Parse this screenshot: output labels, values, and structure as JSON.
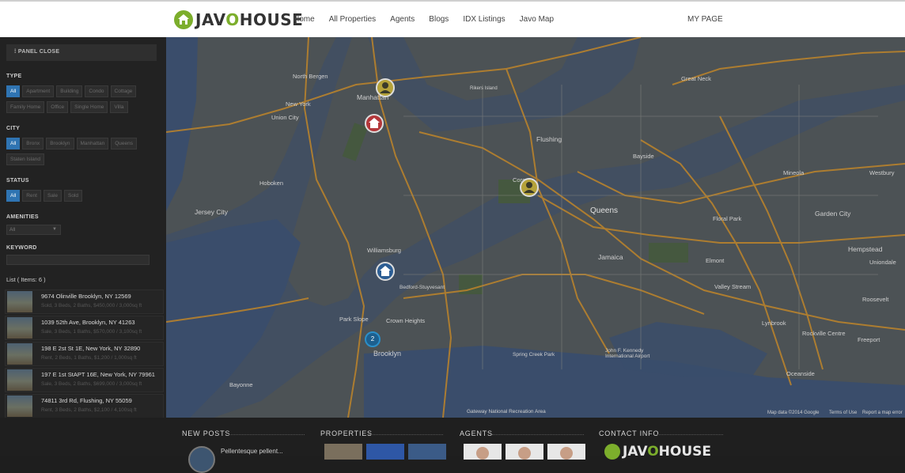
{
  "header": {
    "logo_part1": "JAV",
    "logo_o": "O",
    "logo_part2": "HOUSE",
    "nav": [
      "Home",
      "All Properties",
      "Agents",
      "Blogs",
      "IDX Listings",
      "Javo Map"
    ],
    "my_page": "MY PAGE"
  },
  "panel": {
    "close_label": "PANEL CLOSE",
    "type_label": "TYPE",
    "type_chips": [
      "All",
      "Apartment",
      "Building",
      "Condo",
      "Cottage",
      "Family Home",
      "Office",
      "Single Home",
      "Villa"
    ],
    "city_label": "CITY",
    "city_chips": [
      "All",
      "Bronx",
      "Brooklyn",
      "Manhattan",
      "Queens",
      "Staten Island"
    ],
    "status_label": "STATUS",
    "status_chips": [
      "All",
      "Rent",
      "Sale",
      "Sold"
    ],
    "amenities_label": "AMENITIES",
    "amenities_value": "All",
    "keyword_label": "KEYWORD",
    "keyword_value": "",
    "list_title": "List ( Items: 6 )",
    "listings": [
      {
        "address": "9674 Olinville Brooklyn, NY 12569",
        "meta": "Sold, 3 Beds, 2 Baths, $450,000 / 3,000sq ft"
      },
      {
        "address": "1039 52th Ave, Brooklyn, NY 41263",
        "meta": "Sale, 3 Beds, 1 Baths, $570,000 / 3,100sq ft"
      },
      {
        "address": "198 E 2st St 1E, New York, NY 32890",
        "meta": "Rent, 2 Beds, 1 Baths, $1,200 / 1,000sq ft"
      },
      {
        "address": "197 E 1st StAPT 16E, New York, NY 79961",
        "meta": "Sale, 3 Beds, 2 Baths, $699,000 / 3,000sq ft"
      },
      {
        "address": "74811 3rd Rd, Flushing, NY 55059",
        "meta": "Rent, 3 Beds, 2 Baths, $2,100 / 4,100sq ft"
      }
    ]
  },
  "map": {
    "labels": [
      {
        "text": "North Bergen"
      },
      {
        "text": "Union City"
      },
      {
        "text": "Hoboken"
      },
      {
        "text": "Jersey City"
      },
      {
        "text": "New York"
      },
      {
        "text": "Manhattan"
      },
      {
        "text": "Brooklyn"
      },
      {
        "text": "Queens"
      },
      {
        "text": "Flushing"
      },
      {
        "text": "Jamaica"
      },
      {
        "text": "Hempstead"
      },
      {
        "text": "Garden City"
      },
      {
        "text": "Floral Park"
      },
      {
        "text": "Williamsburg"
      },
      {
        "text": "Bedford-Stuyvesant"
      },
      {
        "text": "Crown Heights"
      },
      {
        "text": "Park Slope"
      },
      {
        "text": "Corona"
      },
      {
        "text": "Bayside"
      },
      {
        "text": "Great Neck"
      },
      {
        "text": "Mineola"
      },
      {
        "text": "Valley Stream"
      },
      {
        "text": "Elmont"
      },
      {
        "text": "Oceanside"
      },
      {
        "text": "Rockville Centre"
      },
      {
        "text": "Freeport"
      },
      {
        "text": "Lynbrook"
      },
      {
        "text": "Uniondale"
      },
      {
        "text": "Westbury"
      },
      {
        "text": "Rikers Island"
      },
      {
        "text": "Roosevelt"
      },
      {
        "text": "Spring Creek Park"
      },
      {
        "text": "Gateway National Recreation Area"
      },
      {
        "text": "John F. Kennedy International Airport"
      },
      {
        "text": "Bayonne"
      }
    ],
    "cluster_count": "2",
    "credit_data": "Map data ©2014 Google",
    "credit_terms": "Terms of Use",
    "credit_report": "Report a map error"
  },
  "footer": {
    "new_posts_title": "NEW POSTS",
    "properties_title": "PROPERTIES",
    "agents_title": "AGENTS",
    "contact_title": "CONTACT INFO",
    "post_title": "Pellentesque pellent..."
  },
  "colors": {
    "brand_green": "#7cae2c",
    "chip_active": "#2f74b2",
    "panel_bg": "#222222",
    "map_water": "#3a4d6b",
    "map_land": "#4a5053"
  }
}
